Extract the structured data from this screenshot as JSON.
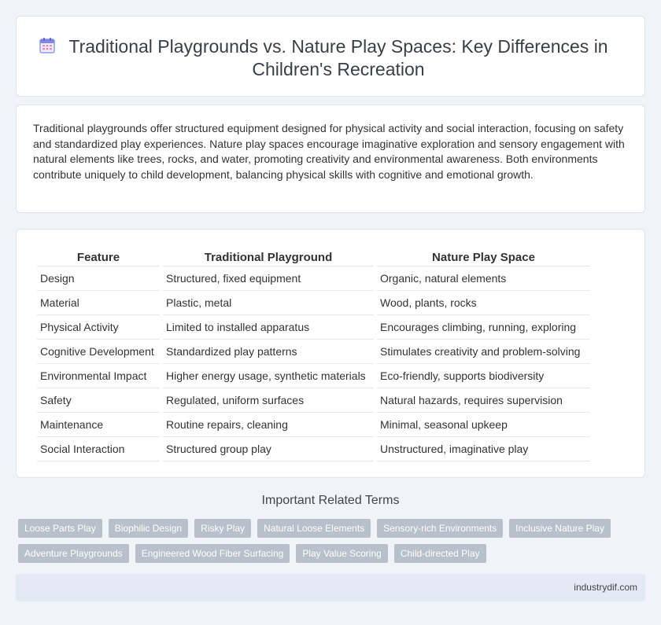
{
  "header": {
    "icon": "calendar-icon",
    "title": "Traditional Playgrounds vs. Nature Play Spaces: Key Differences in Children's Recreation"
  },
  "intro": {
    "text": "Traditional playgrounds offer structured equipment designed for physical activity and social interaction, focusing on safety and standardized play experiences. Nature play spaces encourage imaginative exploration and sensory engagement with natural elements like trees, rocks, and water, promoting creativity and environmental awareness. Both environments contribute uniquely to child development, balancing physical skills with cognitive and emotional growth."
  },
  "table": {
    "headers": [
      "Feature",
      "Traditional Playground",
      "Nature Play Space"
    ],
    "rows": [
      [
        "Design",
        "Structured, fixed equipment",
        "Organic, natural elements"
      ],
      [
        "Material",
        "Plastic, metal",
        "Wood, plants, rocks"
      ],
      [
        "Physical Activity",
        "Limited to installed apparatus",
        "Encourages climbing, running, exploring"
      ],
      [
        "Cognitive Development",
        "Standardized play patterns",
        "Stimulates creativity and problem-solving"
      ],
      [
        "Environmental Impact",
        "Higher energy usage, synthetic materials",
        "Eco-friendly, supports biodiversity"
      ],
      [
        "Safety",
        "Regulated, uniform surfaces",
        "Natural hazards, requires supervision"
      ],
      [
        "Maintenance",
        "Routine repairs, cleaning",
        "Minimal, seasonal upkeep"
      ],
      [
        "Social Interaction",
        "Structured group play",
        "Unstructured, imaginative play"
      ]
    ]
  },
  "related": {
    "title": "Important Related Terms",
    "row1": [
      "Loose Parts Play",
      "Biophilic Design",
      "Risky Play",
      "Natural Loose Elements",
      "Sensory-rich Environments",
      "Inclusive Nature Play"
    ],
    "row2": [
      "Adventure Playgrounds",
      "Engineered Wood Fiber Surfacing",
      "Play Value Scoring",
      "Child-directed Play"
    ]
  },
  "footer": {
    "site": "industrydif.com"
  },
  "colors": {
    "background": "#f0f3f8",
    "tag": "#b7c0cb",
    "footer": "#e3eaf5"
  }
}
